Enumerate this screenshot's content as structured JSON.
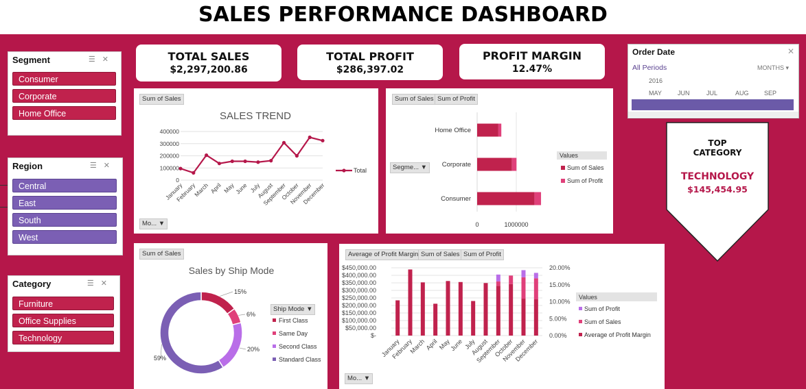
{
  "title": "SALES PERFORMANCE DASHBOARD",
  "slicers": {
    "segment": {
      "header": "Segment",
      "items": [
        "Consumer",
        "Corporate",
        "Home Office"
      ]
    },
    "region": {
      "header": "Region",
      "items": [
        "Central",
        "East",
        "South",
        "West"
      ]
    },
    "category": {
      "header": "Category",
      "items": [
        "Furniture",
        "Office Supplies",
        "Technology"
      ]
    }
  },
  "kpis": [
    {
      "label": "TOTAL SALES",
      "value": "$2,297,200.86"
    },
    {
      "label": "TOTAL PROFIT",
      "value": "$286,397.02"
    },
    {
      "label": "PROFIT MARGIN",
      "value": "12.47%"
    }
  ],
  "timeline": {
    "header": "Order Date",
    "period_label": "All Periods",
    "unit": "MONTHS",
    "year": "2016",
    "months": [
      "MAY",
      "JUN",
      "JUL",
      "AUG",
      "SEP"
    ]
  },
  "top_category": {
    "line1": "TOP",
    "line2": "CATEGORY",
    "name": "TECHNOLOGY",
    "value": "$145,454.95"
  },
  "buttons": {
    "sum_of_sales": "Sum of Sales",
    "sum_of_profit": "Sum of Profit",
    "avg_profit_margin": "Average of Profit Margin",
    "month_dd": "Mo...",
    "segment_dd": "Segme...",
    "ship_mode_dd": "Ship Mode"
  },
  "chart_data": [
    {
      "type": "line",
      "title": "SALES TREND",
      "categories": [
        "January",
        "February",
        "March",
        "April",
        "May",
        "June",
        "July",
        "August",
        "September",
        "October",
        "November",
        "December"
      ],
      "series": [
        {
          "name": "Total",
          "values": [
            95000,
            60000,
            205000,
            137000,
            155000,
            155000,
            148000,
            160000,
            308000,
            200000,
            352000,
            325000
          ]
        }
      ],
      "y_ticks": [
        "0",
        "100000",
        "200000",
        "300000",
        "400000"
      ],
      "ylim": [
        0,
        400000
      ],
      "grid": true,
      "legend": "right",
      "color": "#b5174a"
    },
    {
      "type": "bar",
      "orientation": "horizontal",
      "stacked": true,
      "categories": [
        "Home Office",
        "Corporate",
        "Consumer"
      ],
      "series": [
        {
          "name": "Sum of Sales",
          "values": [
            430000,
            706000,
            1161000
          ],
          "color": "#c0224d"
        },
        {
          "name": "Sum of Profit",
          "values": [
            60000,
            92000,
            134000
          ],
          "color": "#e0407a"
        }
      ],
      "legend_title": "Values",
      "x_ticks": [
        "0",
        "1000000"
      ],
      "xlim": [
        0,
        1350000
      ],
      "legend": "right"
    },
    {
      "type": "pie",
      "donut": true,
      "title": "Sales by Ship Mode",
      "legend_title": "Ship Mode",
      "slices": [
        {
          "name": "First Class",
          "value": 15,
          "label": "15%",
          "color": "#c0224d"
        },
        {
          "name": "Same Day",
          "value": 6,
          "label": "6%",
          "color": "#e0407a"
        },
        {
          "name": "Second Class",
          "value": 20,
          "label": "20%",
          "color": "#b96ee8"
        },
        {
          "name": "Standard Class",
          "value": 59,
          "label": "59%",
          "color": "#7b5fb4"
        }
      ],
      "legend": "right"
    },
    {
      "type": "bar",
      "stacked": true,
      "categories": [
        "January",
        "February",
        "March",
        "April",
        "May",
        "June",
        "July",
        "August",
        "September",
        "October",
        "November",
        "December"
      ],
      "series": [
        {
          "name": "Average of Profit Margin",
          "values": [
            0.104,
            0.195,
            0.157,
            0.094,
            0.161,
            0.158,
            0.102,
            0.155,
            0.147,
            0.152,
            0.109,
            0.107
          ],
          "color": "#c0224d"
        },
        {
          "name": "Sum of Sales",
          "values": [
            0,
            0,
            0,
            0,
            0,
            0,
            0,
            0,
            0.013,
            0.025,
            0.063,
            0.062
          ],
          "color": "#e0407a"
        },
        {
          "name": "Sum of Profit",
          "values": [
            0,
            0,
            0,
            0,
            0,
            0,
            0,
            0,
            0.02,
            0,
            0.021,
            0.016
          ],
          "color": "#b96ee8"
        }
      ],
      "y_ticks_left": [
        "$-",
        "$50,000.00",
        "$100,000.00",
        "$150,000.00",
        "$200,000.00",
        "$250,000.00",
        "$300,000.00",
        "$350,000.00",
        "$400,000.00",
        "$450,000.00"
      ],
      "y_ticks_right": [
        "0.00%",
        "5.00%",
        "10.00%",
        "15.00%",
        "20.00%"
      ],
      "ylim_right": [
        0,
        0.2
      ],
      "legend_title": "Values",
      "legend": "right",
      "grid": true
    }
  ]
}
